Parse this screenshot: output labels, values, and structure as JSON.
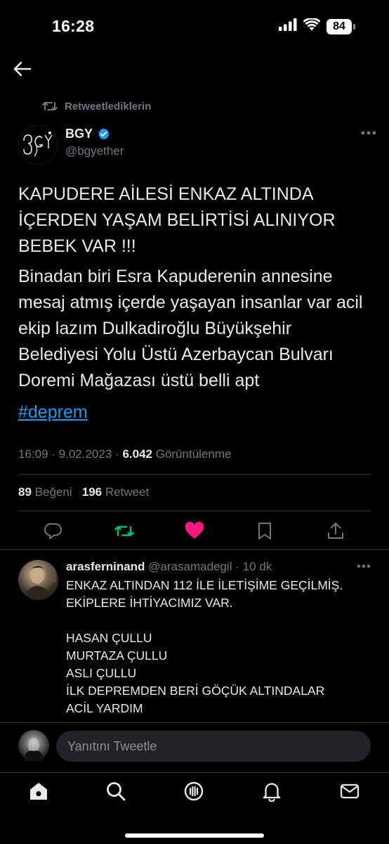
{
  "status_bar": {
    "time": "16:28",
    "battery": "84",
    "icons": [
      "signal-icon",
      "wifi-icon",
      "battery-icon"
    ]
  },
  "nav": {
    "back_icon": "arrow-left-icon"
  },
  "retweet_context": {
    "label": "Retweetlediklerin",
    "icon": "retweet-icon"
  },
  "tweet": {
    "author": {
      "name": "BGY",
      "handle": "@bgyether",
      "verified": true
    },
    "text_caps": "KAPUDERE AİLESİ ENKAZ ALTINDA İÇERDEN YAŞAM BELİRTİSİ ALINIYOR BEBEK VAR !!!",
    "text_body": "Binadan biri Esra Kapuderenin annesine mesaj atmış içerde yaşayan insanlar var acil ekip lazım Dulkadiroğlu Büyükşehir Belediyesi Yolu Üstü Azerbaycan Bulvarı Doremi Mağazası üstü belli apt",
    "hashtag": "#deprem",
    "time": "16:09",
    "date": "9.02.2023",
    "views_count": "6.042",
    "views_label": "Görüntülenme",
    "likes_count": "89",
    "likes_label": "Beğeni",
    "retweets_count": "196",
    "retweets_label": "Retweet",
    "liked": true,
    "retweeted": true
  },
  "reply": {
    "name": "arasferninand",
    "handle": "@arasamadegil",
    "time_ago": "10 dk",
    "text": "ENKAZ ALTINDAN 112 İLE İLETİŞİME GEÇİLMİŞ.\nEKİPLERE İHTİYACIMIZ VAR.\n\nHASAN ÇULLU\nMURTAZA ÇULLU\nASLI ÇULLU\nİLK DEPREMDEN BERİ GÖÇÜK ALTINDALAR\nACİL YARDIM"
  },
  "compose": {
    "placeholder": "Yanıtını Tweetle"
  },
  "tab_bar": {
    "tabs": [
      "home-icon",
      "search-icon",
      "spaces-icon",
      "notifications-icon",
      "messages-icon"
    ]
  },
  "colors": {
    "accent": "#1d9bf0",
    "like": "#f91880",
    "retweet": "#00ba7c",
    "muted": "#71767b",
    "text": "#e7e9ea",
    "background": "#000000"
  }
}
